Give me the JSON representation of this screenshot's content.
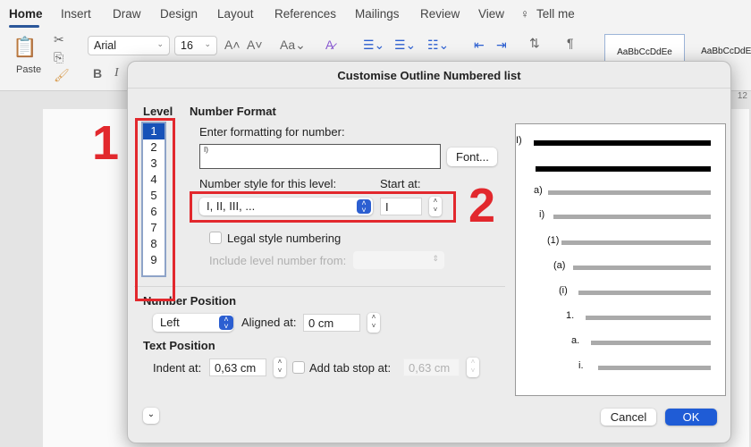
{
  "ribbon": {
    "tabs": [
      "Home",
      "Insert",
      "Draw",
      "Design",
      "Layout",
      "References",
      "Mailings",
      "Review",
      "View",
      "Tell me"
    ],
    "paste": "Paste",
    "font": "Arial",
    "size": "16",
    "bold": "B",
    "italic": "I",
    "styles": [
      "AaBbCcDdEe",
      "AaBbCcDdEe"
    ],
    "ruler_num": "12"
  },
  "dialog": {
    "title": "Customise Outline Numbered list",
    "level_label": "Level",
    "levels": [
      "1",
      "2",
      "3",
      "4",
      "5",
      "6",
      "7",
      "8",
      "9"
    ],
    "selected_level": "1",
    "number_format": "Number Format",
    "enter_formatting": "Enter formatting for number:",
    "format_value": "I)",
    "font_button": "Font...",
    "number_style_label": "Number style for this level:",
    "number_style": "I, II, III, ...",
    "start_at_label": "Start at:",
    "start_at": "I",
    "legal_style": "Legal style numbering",
    "include_level": "Include level number from:",
    "number_position": "Number Position",
    "alignment": "Left",
    "aligned_at_label": "Aligned at:",
    "aligned_at": "0 cm",
    "text_position": "Text Position",
    "indent_at_label": "Indent at:",
    "indent_at": "0,63 cm",
    "add_tab_stop": "Add tab stop at:",
    "tab_stop": "0,63 cm",
    "cancel": "Cancel",
    "ok": "OK",
    "preview": [
      "I)",
      "a)",
      "i)",
      "(1)",
      "(a)",
      "(i)",
      "1.",
      "a.",
      "i."
    ]
  },
  "annotations": {
    "one": "1",
    "two": "2",
    "color": "#e2282d"
  }
}
